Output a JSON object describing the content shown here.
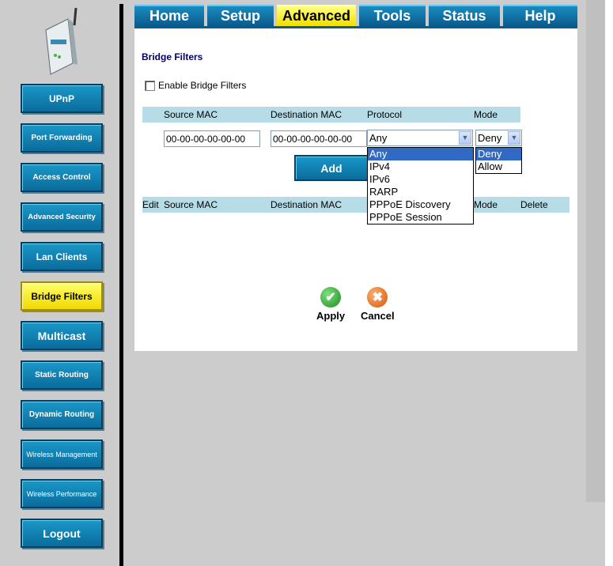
{
  "tabs": [
    {
      "label": "Home"
    },
    {
      "label": "Setup"
    },
    {
      "label": "Advanced"
    },
    {
      "label": "Tools"
    },
    {
      "label": "Status"
    },
    {
      "label": "Help"
    }
  ],
  "sidebar": {
    "items": [
      {
        "label": "UPnP"
      },
      {
        "label": "Port Forwarding"
      },
      {
        "label": "Access Control"
      },
      {
        "label": "Advanced Security"
      },
      {
        "label": "Lan Clients"
      },
      {
        "label": "Bridge Filters"
      },
      {
        "label": "Multicast"
      },
      {
        "label": "Static Routing"
      },
      {
        "label": "Dynamic Routing"
      },
      {
        "label": "Wireless Management"
      },
      {
        "label": "Wireless Performance"
      },
      {
        "label": "Logout"
      }
    ]
  },
  "main": {
    "title": "Bridge Filters",
    "enable_label": "Enable Bridge Filters",
    "form_headers": {
      "source_mac": "Source MAC",
      "destination_mac": "Destination MAC",
      "protocol": "Protocol",
      "mode": "Mode"
    },
    "source_mac_value": "00-00-00-00-00-00",
    "destination_mac_value": "00-00-00-00-00-00",
    "protocol_selected": "Any",
    "mode_selected": "Deny",
    "protocol_options": [
      "Any",
      "IPv4",
      "IPv6",
      "RARP",
      "PPPoE Discovery",
      "PPPoE Session"
    ],
    "mode_options": [
      "Deny",
      "Allow"
    ],
    "add_label": "Add",
    "table_headers": {
      "edit": "Edit",
      "source_mac": "Source MAC",
      "destination_mac": "Destination MAC",
      "mode": "Mode",
      "delete": "Delete"
    },
    "apply_label": "Apply",
    "cancel_label": "Cancel"
  },
  "colors": {
    "tab_blue": "#0a6c9c",
    "active_yellow": "#f2de00",
    "header_row": "#b6dce8",
    "apply_green": "#2ea02e",
    "cancel_orange": "#e8701a"
  }
}
